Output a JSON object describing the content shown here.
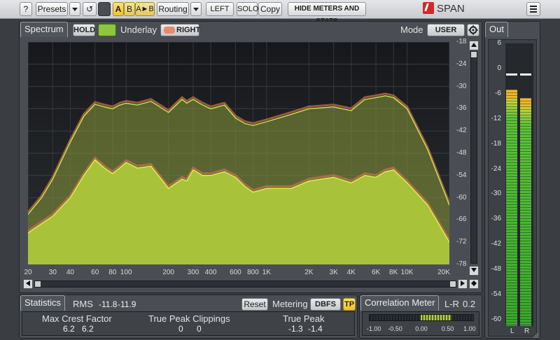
{
  "toolbar": {
    "help_label": "?",
    "presets_label": "Presets",
    "reset_label": "↺",
    "ab": {
      "a": "A",
      "b": "B",
      "copy_ab": "A►B"
    },
    "routing_label": "Routing",
    "left_label": "LEFT",
    "solo_label": "SOLO",
    "copy_label": "Copy",
    "hide_label": "HIDE METERS AND STATS",
    "brand": "SPAN",
    "menu_icon": "hamburger-icon"
  },
  "spectrum": {
    "tab_label": "Spectrum",
    "hold_label": "HOLD",
    "underlay_label": "Underlay",
    "right_label": "RIGHT",
    "mode_label": "Mode",
    "mode_value": "USER",
    "db_ticks": [
      "-18",
      "-24",
      "-30",
      "-36",
      "-42",
      "-48",
      "-54",
      "-60",
      "-66",
      "-72",
      "-78"
    ],
    "hz_ticks": [
      "20",
      "30",
      "40",
      "60",
      "80",
      "100",
      "200",
      "300",
      "400",
      "600",
      "800",
      "1K",
      "2K",
      "3K",
      "4K",
      "6K",
      "8K",
      "10K",
      "20K"
    ],
    "colors": {
      "main_fill": "#a8c23a",
      "main_line": "#d8f04a",
      "underlay_fill": "#c9734f",
      "hold_on": "#8dc63f"
    }
  },
  "chart_data": {
    "type": "area",
    "x_scale": "log",
    "xlim": [
      20,
      20000
    ],
    "ylim": [
      -78,
      -18
    ],
    "x": [
      20,
      25,
      30,
      40,
      50,
      60,
      70,
      80,
      90,
      100,
      120,
      150,
      200,
      250,
      270,
      300,
      350,
      400,
      500,
      600,
      700,
      800,
      1000,
      1500,
      2000,
      3000,
      4000,
      5000,
      6000,
      7000,
      8000,
      10000,
      14000,
      20000
    ],
    "series": [
      {
        "values": [
          -69.5,
          -67,
          -65,
          -60,
          -54,
          -49.8,
          -52,
          -53.5,
          -52,
          -50.5,
          -52,
          -51.5,
          -57.5,
          -55,
          -55.5,
          -52.5,
          -54,
          -54,
          -53,
          -54.5,
          -57,
          -58.5,
          -57.5,
          -57.5,
          -55.5,
          -54.5,
          -56,
          -54,
          -54.5,
          -53,
          -52.5,
          -56,
          -62,
          -72
        ]
      },
      {
        "values": [
          -64.5,
          -60,
          -55,
          -45,
          -38,
          -34.8,
          -35.5,
          -36,
          -35,
          -34.5,
          -35,
          -34,
          -37,
          -33.5,
          -34.5,
          -33.5,
          -35,
          -36,
          -35,
          -38.5,
          -40,
          -40.5,
          -39.5,
          -37.5,
          -36,
          -35.5,
          -36.5,
          -33.5,
          -33,
          -32.5,
          -33,
          -36,
          -47,
          -62
        ]
      }
    ]
  },
  "output_meter": {
    "tab_label": "Out",
    "ticks": [
      "6",
      "0",
      "-6",
      "-12",
      "-18",
      "-24",
      "-30",
      "-36",
      "-42",
      "-48",
      "-54",
      "-60"
    ],
    "channels": [
      "L",
      "R"
    ],
    "left_level_db": -5,
    "right_level_db": -7,
    "left_peak_db": -1.3,
    "right_peak_db": -1.4
  },
  "statistics": {
    "tab_label": "Statistics",
    "rms_label": "RMS",
    "rms_left": "-11.8",
    "rms_right": "-11.9",
    "reset_label": "Reset",
    "metering_label": "Metering",
    "metering_value": "DBFS",
    "tp_label": "TP",
    "max_crest_label": "Max Crest Factor",
    "max_crest_left": "6.2",
    "max_crest_right": "6.2",
    "tp_clip_label": "True Peak Clippings",
    "tp_clip_left": "0",
    "tp_clip_right": "0",
    "true_peak_label": "True Peak",
    "true_peak_left": "-1.3",
    "true_peak_right": "-1.4"
  },
  "correlation": {
    "tab_label": "Correlation Meter",
    "lr_label": "L-R",
    "lr_value": "0.2",
    "scale": [
      "-1.00",
      "-0.50",
      "0.00",
      "0.50",
      "1.00"
    ]
  }
}
